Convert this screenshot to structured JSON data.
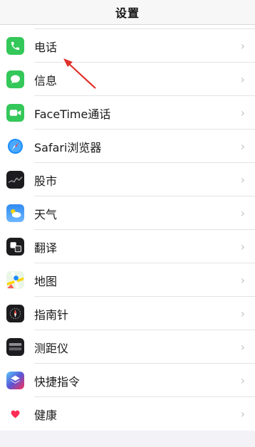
{
  "nav": {
    "title": "设置"
  },
  "settings_items": [
    {
      "id": "phone",
      "label": "电话",
      "icon": "phone-icon",
      "color": "#34c759"
    },
    {
      "id": "messages",
      "label": "信息",
      "icon": "message-bubble-icon",
      "color": "#34c759"
    },
    {
      "id": "facetime",
      "label": "FaceTime通话",
      "icon": "video-camera-icon",
      "color": "#34c759"
    },
    {
      "id": "safari",
      "label": "Safari浏览器",
      "icon": "compass-icon",
      "color": "#1a8cff"
    },
    {
      "id": "stocks",
      "label": "股市",
      "icon": "stocks-chart-icon",
      "color": "#1c1c1e"
    },
    {
      "id": "weather",
      "label": "天气",
      "icon": "cloud-sun-icon",
      "color": "#2f8bf0"
    },
    {
      "id": "translate",
      "label": "翻译",
      "icon": "translate-icon",
      "color": "#1c1c1e"
    },
    {
      "id": "maps",
      "label": "地图",
      "icon": "map-icon",
      "color": "#7ed07a"
    },
    {
      "id": "compass",
      "label": "指南针",
      "icon": "compass-dial-icon",
      "color": "#1c1c1e"
    },
    {
      "id": "measure",
      "label": "测距仪",
      "icon": "ruler-icon",
      "color": "#1c1c1e"
    },
    {
      "id": "shortcuts",
      "label": "快捷指令",
      "icon": "shortcuts-icon",
      "color": "#5856d6"
    },
    {
      "id": "health",
      "label": "健康",
      "icon": "heart-icon",
      "color": "#ff2d55"
    }
  ],
  "chevron": "›",
  "annotation": {
    "color": "#e0302a"
  }
}
